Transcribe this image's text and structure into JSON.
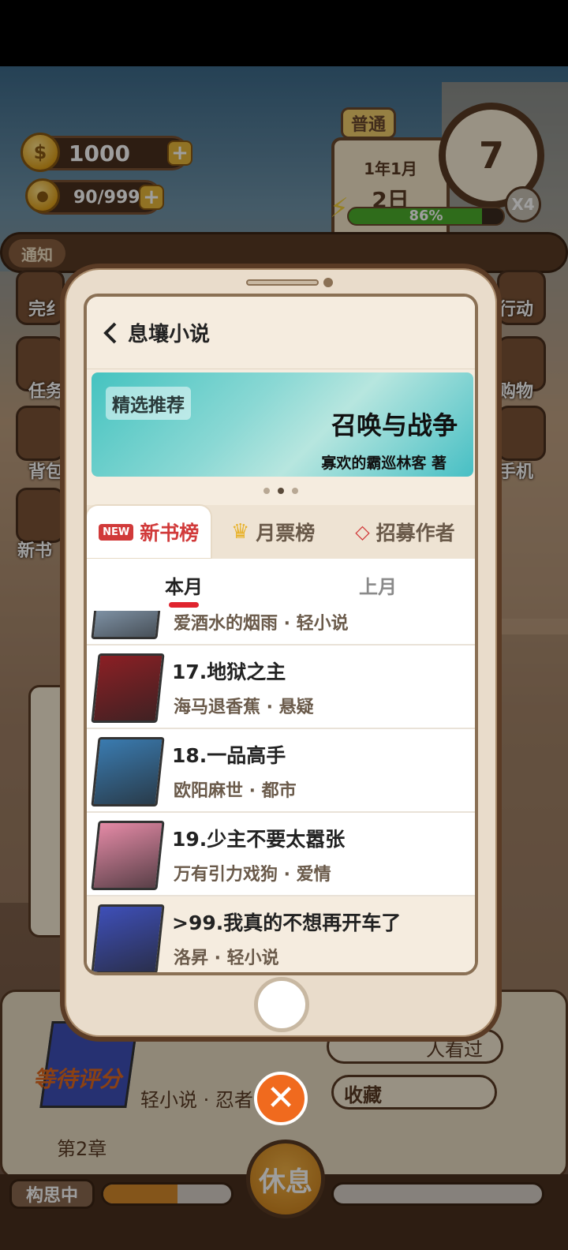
{
  "hud": {
    "coins": "1000",
    "ideas": "90/999",
    "difficulty": "普通",
    "date_year_month": "1年1月",
    "date_day": "2日",
    "clock_hour": "7",
    "speed": "X4",
    "energy_percent_label": "86%",
    "energy_fraction": 0.86,
    "notice_label": "通知"
  },
  "side_menu": {
    "left": [
      "完纟",
      "任务",
      "背包",
      "新书"
    ],
    "right": [
      "行动",
      "购物",
      "手机"
    ]
  },
  "background": {
    "bg_book_status": "等待评分",
    "bg_book_genre": "轻小说 · 忍者",
    "bg_chapter": "第2章",
    "bg_views": "人看过",
    "bg_collect": "收藏",
    "bg_thinking": "构思中",
    "bg_rest": "休息"
  },
  "app": {
    "title": "息壤小说",
    "banner": {
      "tag": "精选推荐",
      "title": "召唤与战争",
      "author": "寡欢的霸巡林客  著"
    },
    "tabs": [
      {
        "label": "新书榜",
        "badge": "NEW",
        "active": true
      },
      {
        "label": "月票榜",
        "active": false
      },
      {
        "label": "招募作者",
        "active": false
      }
    ],
    "subtabs": [
      {
        "label": "本月",
        "active": true
      },
      {
        "label": "上月",
        "active": false
      }
    ],
    "list": [
      {
        "title": "",
        "subtitle": "爱酒水的烟雨 · 轻小说",
        "cover": "#a8c4e0",
        "partial": true
      },
      {
        "title": "17.地狱之主",
        "subtitle": "海马退香蕉 · 悬疑",
        "cover": "#8b1f24"
      },
      {
        "title": "18.一品高手",
        "subtitle": "欧阳麻世 · 都市",
        "cover": "#3a7bb0"
      },
      {
        "title": "19.少主不要太嚣张",
        "subtitle": "万有引力戏狗 · 爱情",
        "cover": "#e48aa6"
      },
      {
        "title": ">99.我真的不想再开车了",
        "subtitle": "洛昇 · 轻小说",
        "cover": "#3e4fb8",
        "mine": true
      }
    ]
  }
}
